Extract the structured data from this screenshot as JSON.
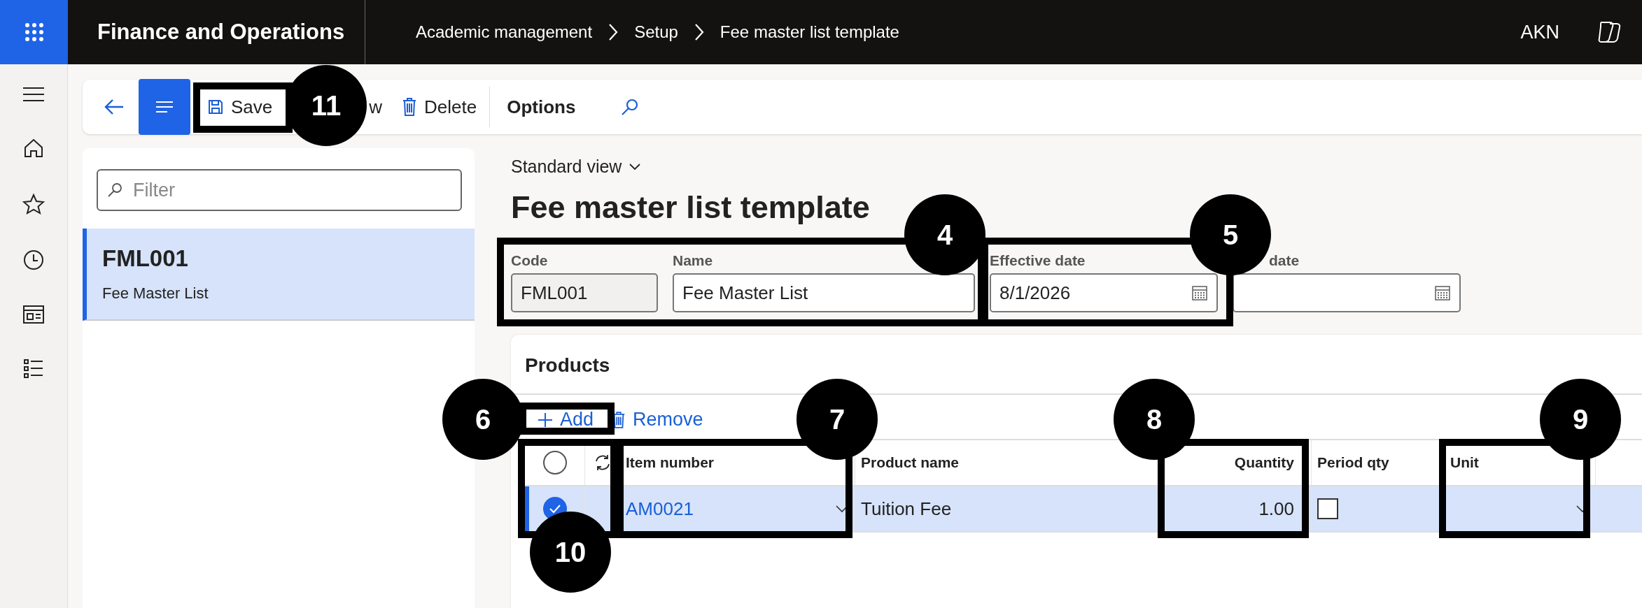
{
  "app_bar": {
    "title": "Finance and Operations",
    "breadcrumbs": [
      "Academic management",
      "Setup",
      "Fee master list template"
    ],
    "user": "AKN"
  },
  "toolbar": {
    "buttons": [
      {
        "kind": "save",
        "label": "Save"
      },
      {
        "kind": "new",
        "label": "w"
      },
      {
        "kind": "delete",
        "label": "Delete"
      },
      {
        "kind": "options",
        "label": "Options"
      }
    ]
  },
  "list_panel": {
    "filter": {
      "placeholder": "Filter"
    },
    "items": [
      {
        "code": "FML001",
        "name": "Fee Master List",
        "selected": true
      }
    ]
  },
  "view": "Standard view",
  "page_title": "Fee master list template",
  "fields": [
    {
      "label": "Code",
      "value": "FML001",
      "kind": "text",
      "disabled": true
    },
    {
      "label": "Name",
      "value": "Fee Master List",
      "kind": "text",
      "disabled": false
    },
    {
      "label": "Effective date",
      "value": "8/1/2026",
      "kind": "date",
      "disabled": false
    },
    {
      "label": "date",
      "kind": "date",
      "disabled": false
    }
  ],
  "products": {
    "title": "Products",
    "actions": [
      {
        "kind": "add",
        "label": "Add"
      },
      {
        "kind": "remove",
        "label": "Remove"
      }
    ],
    "columns": [
      "Item number",
      "Product name",
      "Quantity",
      "Period qty",
      "Unit"
    ],
    "rows": [
      {
        "selected": true,
        "item_number": "AM0021",
        "product_name": "Tuition Fee",
        "quantity": "1.00",
        "period_qty": false
      }
    ]
  },
  "callouts": [
    "11",
    "4",
    "5",
    "6",
    "7",
    "8",
    "9",
    "10"
  ]
}
